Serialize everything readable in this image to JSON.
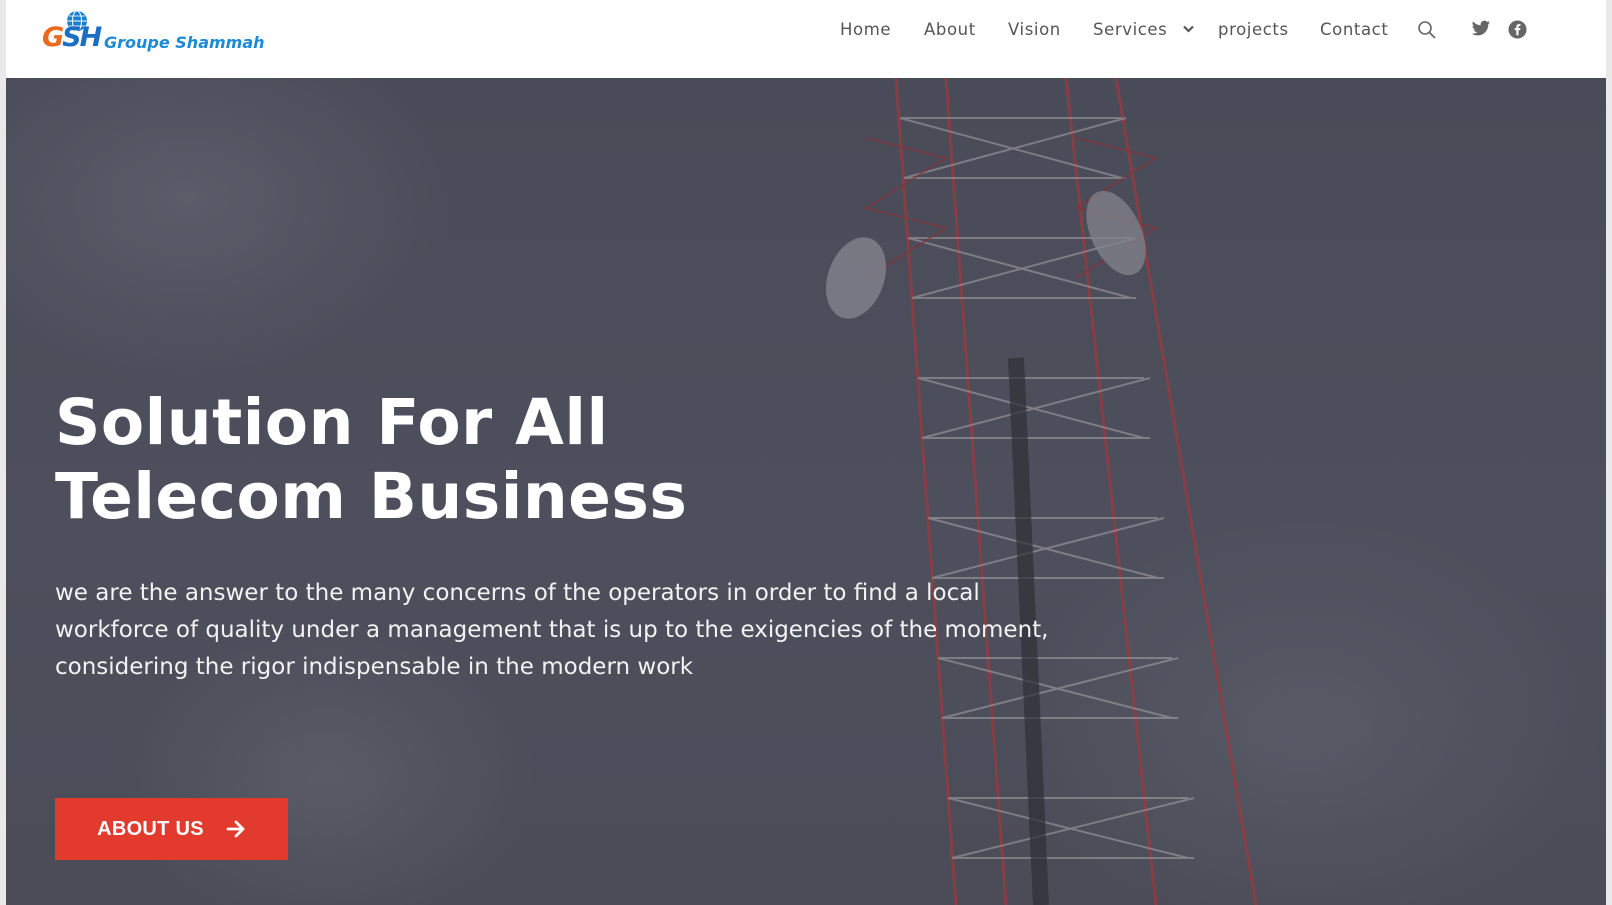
{
  "header": {
    "logo": {
      "mark": "GSH",
      "name": "Groupe Shammah"
    },
    "nav": [
      {
        "label": "Home"
      },
      {
        "label": "About"
      },
      {
        "label": "Vision"
      },
      {
        "label": "Services",
        "has_dropdown": true
      },
      {
        "label": "projects"
      },
      {
        "label": "Contact"
      }
    ],
    "icons": [
      "search-icon",
      "twitter-icon",
      "facebook-icon"
    ]
  },
  "hero": {
    "title_line1": "Solution For All",
    "title_line2": "Telecom Business",
    "text": "we are the answer to the many concerns of the operators in order to find a local workforce of quality under a management that is up to the exigencies of the moment, considering the rigor indispensable in the modern work",
    "cta_label": "ABOUT US"
  },
  "colors": {
    "accent": "#e23a2c",
    "nav_text": "#555555",
    "hero_overlay": "#4a4b57",
    "logo_orange": "#e86a1a",
    "logo_blue": "#1c8ad6"
  }
}
